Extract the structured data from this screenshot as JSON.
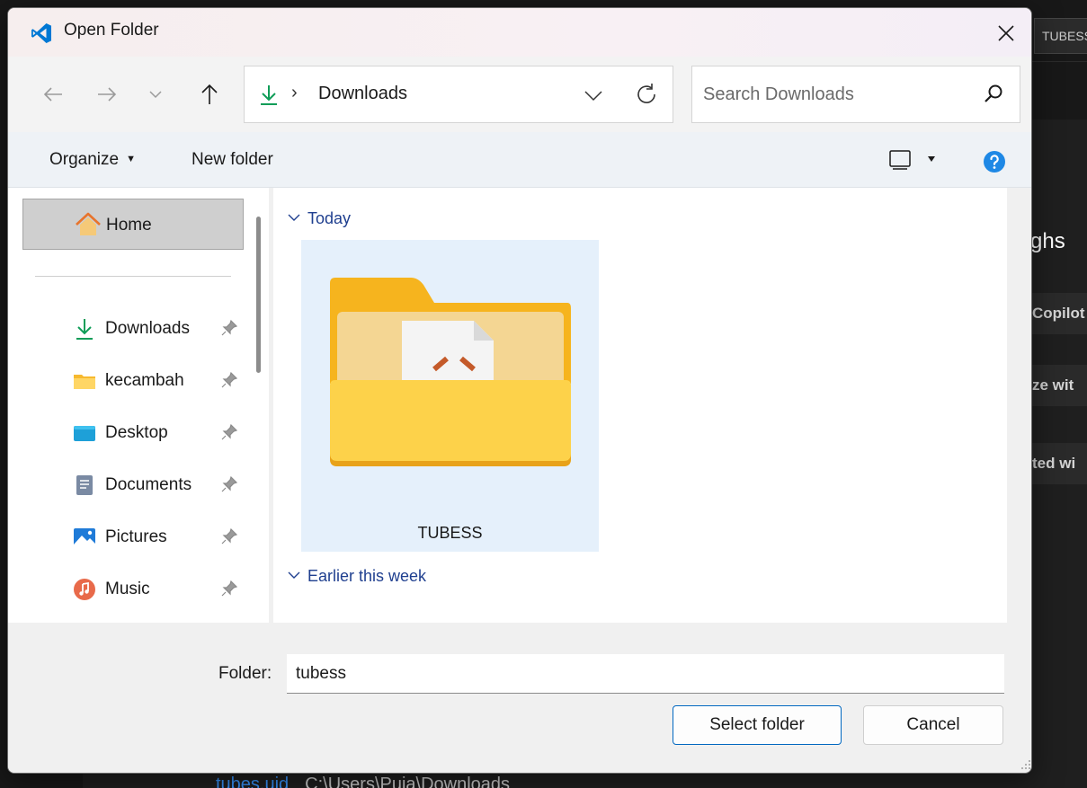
{
  "background": {
    "tab_label": "TUBESS",
    "heading": "ghs",
    "buttons": [
      "Copilot",
      "ze wit",
      "ted wi"
    ],
    "recent_name": "tubes.uid",
    "recent_path": "C:\\Users\\Puja\\Downloads"
  },
  "dialog": {
    "title": "Open Folder",
    "icons": {
      "app": "vscode-icon",
      "close": "close-icon",
      "back": "back-arrow-icon",
      "forward": "forward-arrow-icon",
      "recent": "chevron-down-icon",
      "up": "up-arrow-icon",
      "refresh": "refresh-icon",
      "search": "search-icon",
      "help": "help-icon",
      "view": "view-pane-icon"
    },
    "address": {
      "separator": "›",
      "location": "Downloads"
    },
    "search": {
      "placeholder": "Search Downloads"
    },
    "toolbar": {
      "organize": "Organize",
      "new_folder": "New folder"
    },
    "nav": {
      "home": "Home",
      "items": [
        {
          "label": "Downloads",
          "icon": "download-icon",
          "pinned": true
        },
        {
          "label": "kecambah",
          "icon": "folder-icon",
          "pinned": true
        },
        {
          "label": "Desktop",
          "icon": "desktop-icon",
          "pinned": true
        },
        {
          "label": "Documents",
          "icon": "documents-icon",
          "pinned": true
        },
        {
          "label": "Pictures",
          "icon": "pictures-icon",
          "pinned": true
        },
        {
          "label": "Music",
          "icon": "music-icon",
          "pinned": true
        }
      ]
    },
    "groups": [
      {
        "label": "Today",
        "expanded": true
      },
      {
        "label": "Earlier this week",
        "expanded": true
      }
    ],
    "items": [
      {
        "name": "TUBESS",
        "type": "folder",
        "selected": true
      }
    ],
    "folder_field": {
      "label": "Folder:",
      "value": "tubess"
    },
    "buttons": {
      "select": "Select folder",
      "cancel": "Cancel"
    }
  },
  "colors": {
    "accent": "#0067c0",
    "group_header": "#1f3f8f",
    "selection": "#e5f0fb",
    "download_green": "#0f9d58",
    "help_blue": "#1e88e5"
  }
}
